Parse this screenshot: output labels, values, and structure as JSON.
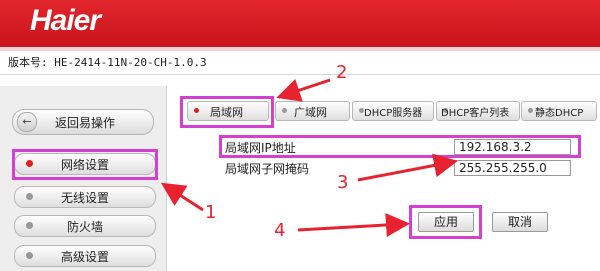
{
  "header": {
    "brand": "Haier"
  },
  "version_text": "版本号: HE-2414-11N-20-CH-1.0.3",
  "sidebar": {
    "back_label": "返回易操作",
    "items": [
      {
        "label": "网络设置",
        "active": true
      },
      {
        "label": "无线设置",
        "active": false
      },
      {
        "label": "防火墙",
        "active": false
      },
      {
        "label": "高级设置",
        "active": false
      }
    ]
  },
  "tabs": [
    {
      "label": "局域网",
      "active": true
    },
    {
      "label": "广域网",
      "active": false
    },
    {
      "label": "DHCP服务器",
      "active": false
    },
    {
      "label": "DHCP客户列表",
      "active": false
    },
    {
      "label": "静态DHCP",
      "active": false
    }
  ],
  "form": {
    "ip_label": "局域网IP地址",
    "ip_value": "192.168.3.2",
    "mask_label": "局域网子网掩码",
    "mask_value": "255.255.255.0"
  },
  "buttons": {
    "apply": "应用",
    "cancel": "取消"
  },
  "annotations": {
    "n1": "1",
    "n2": "2",
    "n3": "3",
    "n4": "4"
  },
  "colors": {
    "header_red": "#c8141c",
    "highlight": "#d43fd4",
    "annotation_red": "#e8222e"
  }
}
